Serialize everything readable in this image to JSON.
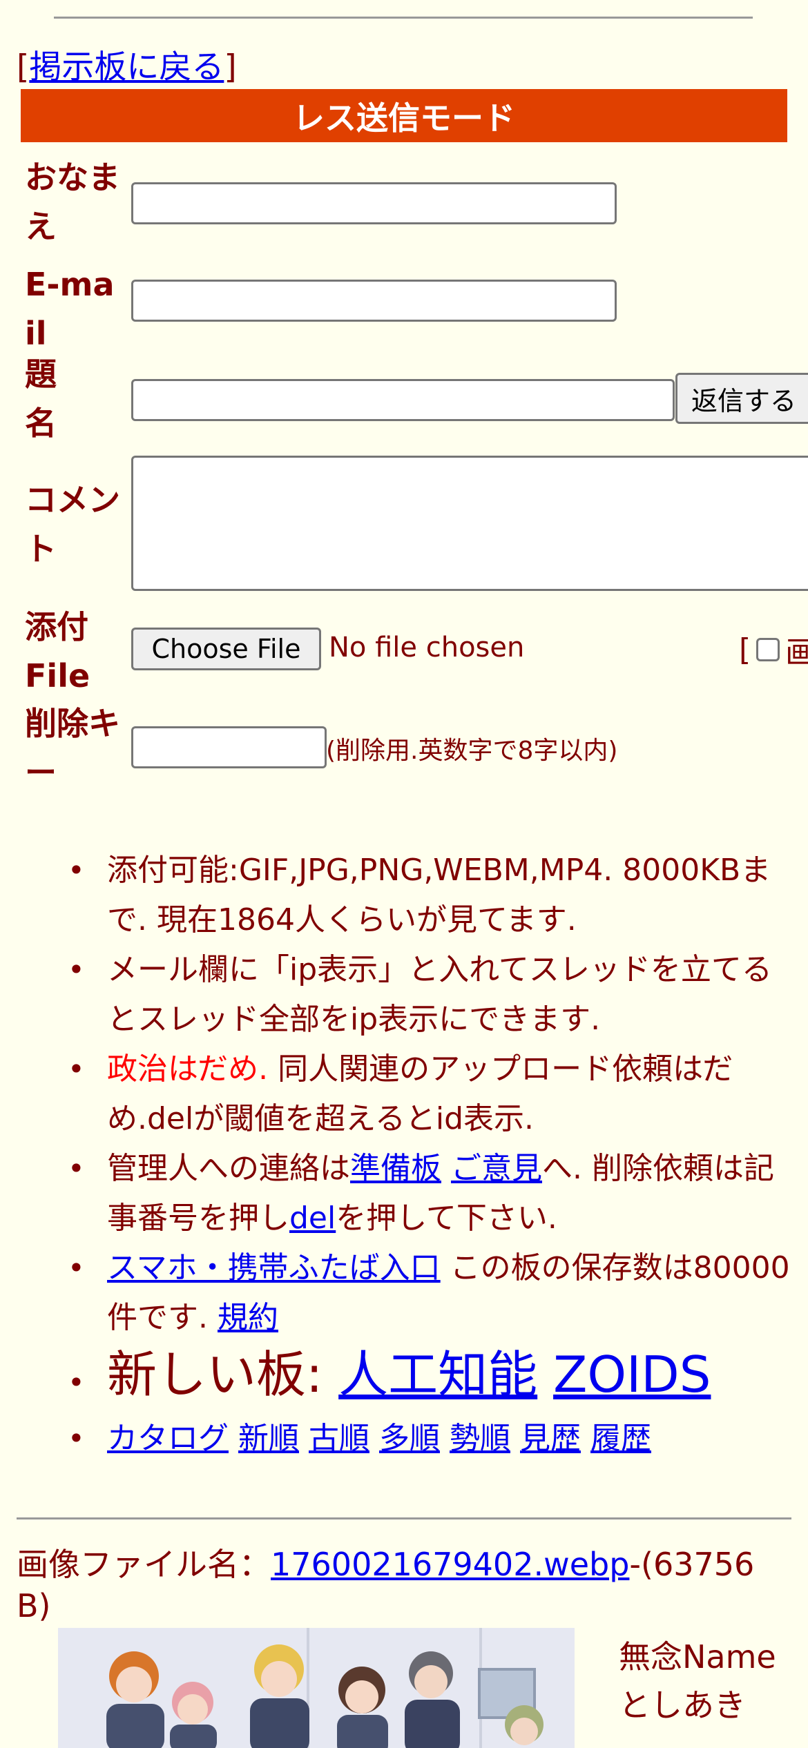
{
  "nav": {
    "back_prefix": "[",
    "back_label": "掲示板に戻る",
    "back_suffix": "]"
  },
  "mode_title": "レス送信モード",
  "form": {
    "name_label": "おなまえ",
    "email_label": "E-mail",
    "subject_label": "題名",
    "submit_label": "返信する",
    "comment_label": "コメント",
    "file_label": "添付File",
    "choose_file_label": "Choose File",
    "file_status": "No file chosen",
    "image_option_prefix": "[",
    "image_option_text": "画",
    "delkey_label": "削除キー",
    "delkey_note": "(削除用.英数字で8字以内)"
  },
  "rules": {
    "r1": "添付可能:GIF,JPG,PNG,WEBM,MP4. 8000KBまで. 現在1864人くらいが見てます.",
    "r2": "メール欄に「ip表示」と入れてスレッドを立てるとスレッド全部をip表示にできます.",
    "r3_red": "政治はだめ.",
    "r3_rest": " 同人関連のアップロード依頼はだめ.delが閾値を超えるとid表示.",
    "r4_a": "管理人への連絡は",
    "r4_link1": "準備板",
    "r4_sp": " ",
    "r4_link2": "ご意見",
    "r4_b": "へ. 削除依頼は記事番号を押し",
    "r4_link3": "del",
    "r4_c": "を押して下さい.",
    "r5_link": "スマホ・携帯ふたば入口",
    "r5_text": " この板の保存数は80000件です. ",
    "r5_link2": "規約",
    "r6_text": "新しい板: ",
    "r6_link1": "人工知能",
    "r6_link2": "ZOIDS",
    "r7_links": [
      "カタログ",
      "新順",
      "古順",
      "多順",
      "勢順",
      "見歴",
      "履歴"
    ]
  },
  "post": {
    "file_prefix": "画像ファイル名：",
    "file_name": "1760021679402.webp",
    "file_size": "-(63756 B)",
    "name_line1": "無念Name",
    "name_line2": "としあき"
  },
  "colors": {
    "background": "#ffffee",
    "text": "#800000",
    "mode_bar": "#e04000",
    "link": "#0000ee",
    "warning": "#ff0000"
  }
}
